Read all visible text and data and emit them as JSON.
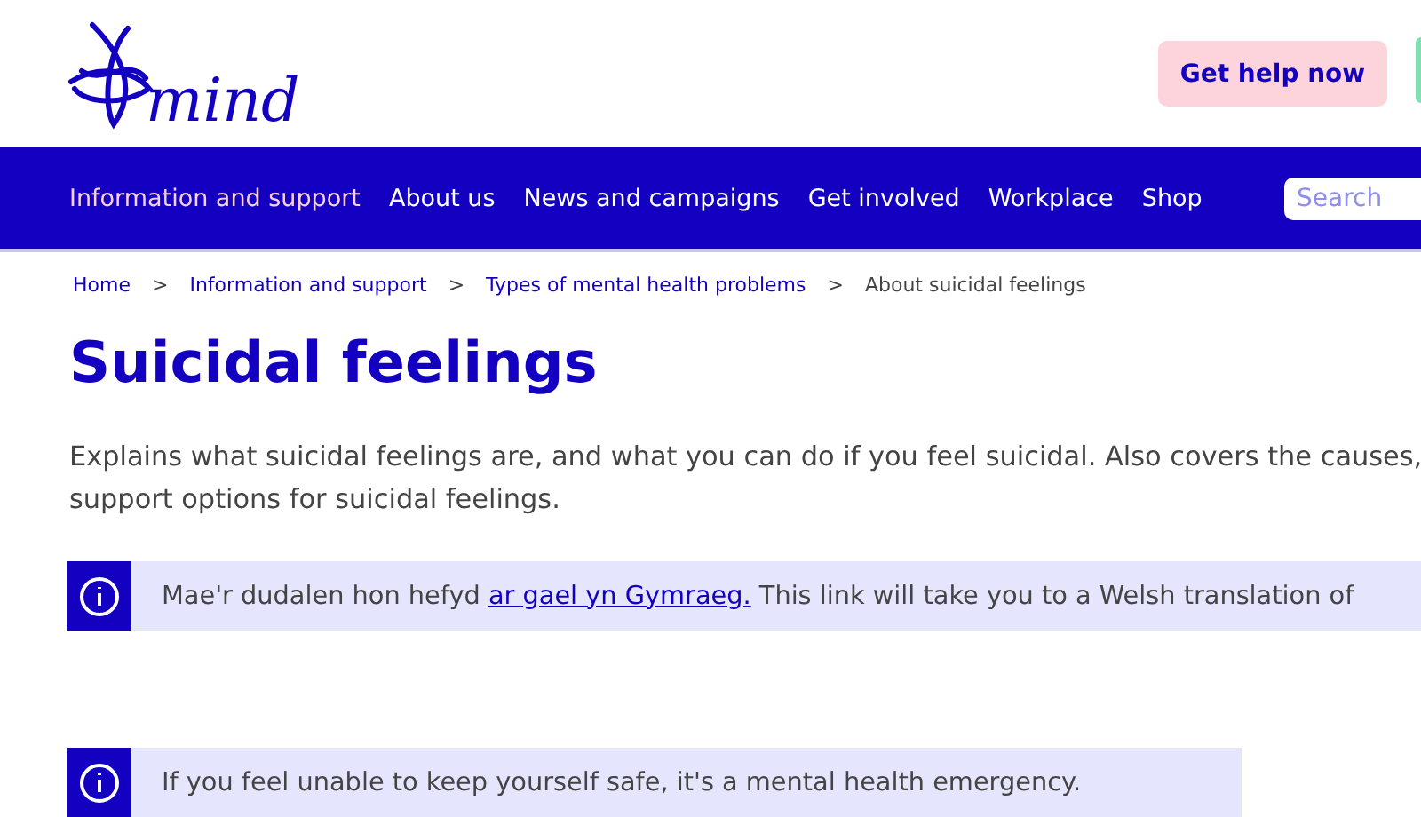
{
  "header": {
    "logo_text": "mind",
    "help_button": "Get help now"
  },
  "nav": {
    "items": [
      {
        "label": "Information and support",
        "selected": true
      },
      {
        "label": "About us",
        "selected": false
      },
      {
        "label": "News and campaigns",
        "selected": false
      },
      {
        "label": "Get involved",
        "selected": false
      },
      {
        "label": "Workplace",
        "selected": false
      },
      {
        "label": "Shop",
        "selected": false
      }
    ],
    "search": {
      "placeholder": "Search"
    }
  },
  "breadcrumb": [
    {
      "label": "Home",
      "current": false
    },
    {
      "label": "Information and support",
      "current": false
    },
    {
      "label": "Types of mental health problems",
      "current": false
    },
    {
      "label": "About suicidal feelings",
      "current": true
    }
  ],
  "breadcrumb_separator": ">",
  "title": "Suicidal feelings",
  "intro_lines": [
    "Explains what suicidal feelings are, and what you can do if you feel suicidal. Also covers the causes,",
    "support options for suicidal feelings."
  ],
  "notices": [
    {
      "before": "Mae'r dudalen hon hefyd ",
      "link": "ar gael yn Gymraeg.",
      "after": " This link will take you to a Welsh translation of"
    },
    {
      "before": "If you feel unable to keep yourself safe, it's a mental health emergency."
    }
  ]
}
